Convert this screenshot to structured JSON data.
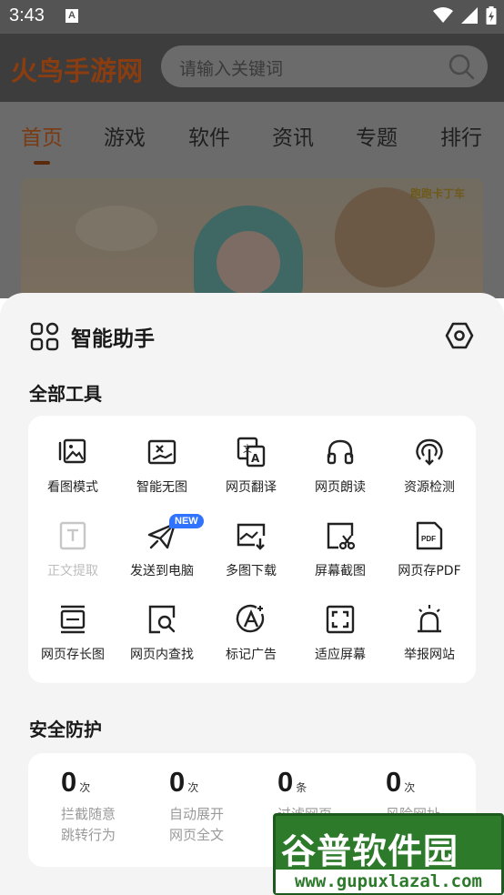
{
  "status_bar": {
    "time": "3:43",
    "notification_glyph": "A",
    "icons": [
      "wifi-icon",
      "signal-icon",
      "battery-icon"
    ]
  },
  "header": {
    "site_logo": "火鸟手游网",
    "search_placeholder": "请输入关键词"
  },
  "nav": {
    "tabs": [
      "首页",
      "游戏",
      "软件",
      "资讯",
      "专题",
      "排行"
    ],
    "active_index": 0
  },
  "banner": {
    "logo_text": "跑跑卡丁车"
  },
  "assistant": {
    "title": "智能助手",
    "tools_section_title": "全部工具",
    "tools": [
      {
        "label": "看图模式",
        "icon": "image-gallery-icon",
        "enabled": true
      },
      {
        "label": "智能无图",
        "icon": "no-image-icon",
        "enabled": true
      },
      {
        "label": "网页翻译",
        "icon": "translate-icon",
        "enabled": true
      },
      {
        "label": "网页朗读",
        "icon": "headphones-icon",
        "enabled": true
      },
      {
        "label": "资源检测",
        "icon": "resource-sniff-icon",
        "enabled": true
      },
      {
        "label": "正文提取",
        "icon": "text-extract-icon",
        "enabled": false
      },
      {
        "label": "发送到电脑",
        "icon": "send-to-pc-icon",
        "enabled": true,
        "badge": "NEW"
      },
      {
        "label": "多图下载",
        "icon": "multi-image-download-icon",
        "enabled": true
      },
      {
        "label": "屏幕截图",
        "icon": "screenshot-scissors-icon",
        "enabled": true
      },
      {
        "label": "网页存PDF",
        "icon": "pdf-icon",
        "enabled": true
      },
      {
        "label": "网页存长图",
        "icon": "long-screenshot-icon",
        "enabled": true
      },
      {
        "label": "网页内查找",
        "icon": "find-in-page-icon",
        "enabled": true
      },
      {
        "label": "标记广告",
        "icon": "mark-ad-icon",
        "enabled": true
      },
      {
        "label": "适应屏幕",
        "icon": "fit-screen-icon",
        "enabled": true
      },
      {
        "label": "举报网站",
        "icon": "report-alarm-icon",
        "enabled": true
      }
    ],
    "security_section_title": "安全防护",
    "stats": [
      {
        "value": "0",
        "unit": "次",
        "label_line1": "拦截随意",
        "label_line2": "跳转行为"
      },
      {
        "value": "0",
        "unit": "次",
        "label_line1": "自动展开",
        "label_line2": "网页全文"
      },
      {
        "value": "0",
        "unit": "条",
        "label_line1": "过滤网页",
        "label_line2": ""
      },
      {
        "value": "0",
        "unit": "次",
        "label_line1": "风险网址",
        "label_line2": ""
      }
    ]
  },
  "watermark": {
    "title": "谷普软件园",
    "url": "www.gupuxlazal.com"
  },
  "colors": {
    "accent_blue": "#2f73ff",
    "text_primary": "#1a1a1a",
    "text_muted": "#9a9a9a",
    "sheet_bg": "#f4f4f4"
  }
}
